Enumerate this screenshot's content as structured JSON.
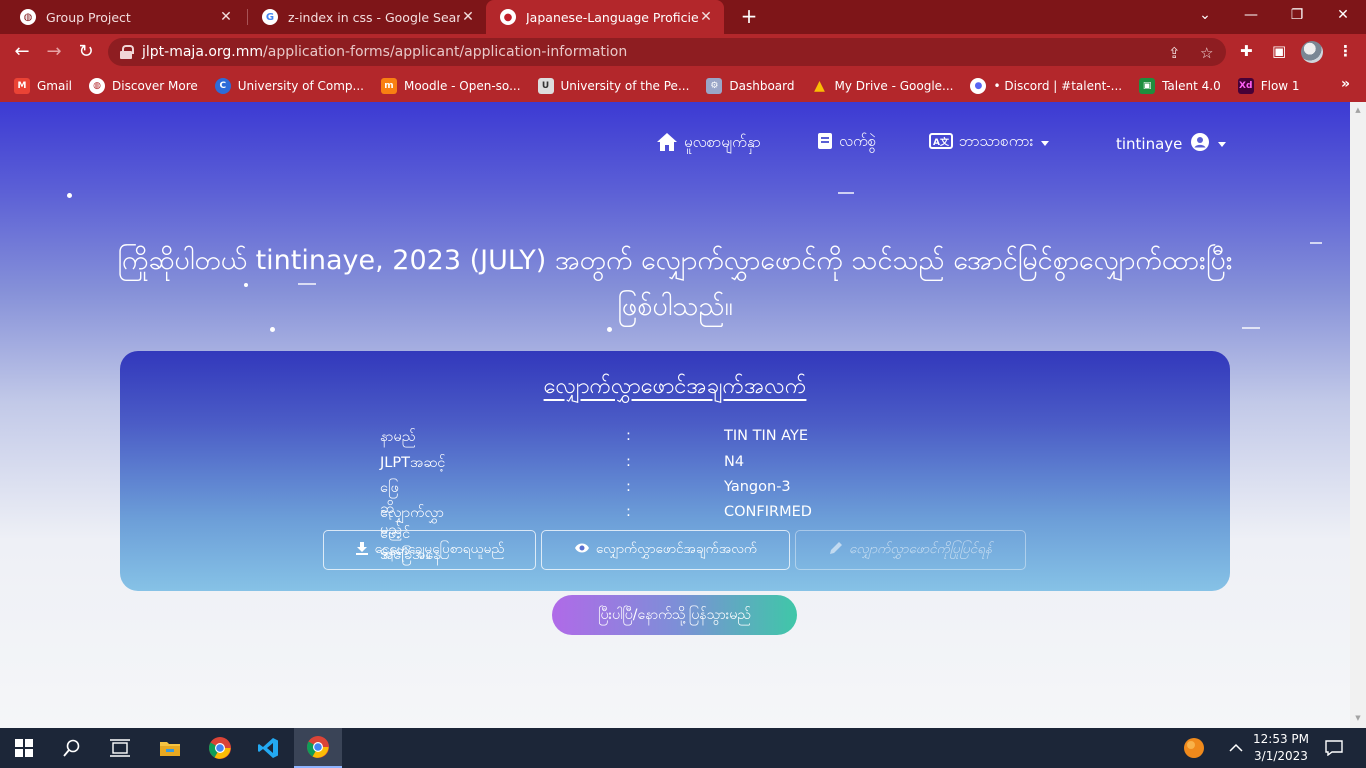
{
  "browser": {
    "tabs": [
      {
        "title": "Group Project",
        "icon": "globe-icon",
        "active": false
      },
      {
        "title": "z-index in css - Google Search",
        "icon": "google-icon",
        "active": false
      },
      {
        "title": "Japanese-Language Proficiency Test",
        "icon": "jlpt-icon",
        "active": true
      }
    ],
    "close_glyph": "✕",
    "new_tab_glyph": "+",
    "url_host": "jlpt-maja.org.mm",
    "url_path": "/application-forms/applicant/application-information",
    "bookmarks": [
      {
        "label": "Gmail",
        "icon": "gmail-icon",
        "color": "#ea4335"
      },
      {
        "label": "Discover More",
        "icon": "globe-icon",
        "color": "#ffffff"
      },
      {
        "label": "University of Comp...",
        "icon": "c-icon",
        "color": "#2d6bd8"
      },
      {
        "label": "Moodle - Open-so...",
        "icon": "moodle-icon",
        "color": "#f98012"
      },
      {
        "label": "University of the Pe...",
        "icon": "uop-icon",
        "color": "#dddddd"
      },
      {
        "label": "Dashboard",
        "icon": "dashboard-icon",
        "color": "#9aa6c8"
      },
      {
        "label": "My Drive - Google...",
        "icon": "drive-icon",
        "color": "#1fa463"
      },
      {
        "label": "• Discord | #talent-...",
        "icon": "discord-icon",
        "color": "#ffffff"
      },
      {
        "label": "Talent 4.0",
        "icon": "classroom-icon",
        "color": "#1e8e3e"
      },
      {
        "label": "Flow 1",
        "icon": "xd-icon",
        "color": "#470137"
      }
    ]
  },
  "nav": {
    "home": "မူလစာမျက်နှာ",
    "manual": "လက်စွဲ",
    "language": "ဘာသာစကား",
    "user": "tintinaye"
  },
  "headline": "ကြိုဆိုပါတယ် tintinaye, 2023 (JULY) အတွက် လျှောက်လွှာဖောင်ကို သင်သည် အောင်မြင်စွာလျှောက်ထားပြီးဖြစ်ပါသည်။",
  "card": {
    "title": "လျှောက်လွှာဖောင်အချက်အလက်",
    "separator": ":",
    "rows": [
      {
        "label": "နာမည်",
        "value": "TIN TIN AYE"
      },
      {
        "label": "JLPTအဆင့်",
        "value": "N4"
      },
      {
        "label": "ဖြေဆိုမည့်နေရာ",
        "value": "Yangon-3"
      },
      {
        "label": "လျှောက်လွှာဖောင်အခြေအနေ",
        "value": "CONFIRMED"
      }
    ],
    "buttons": {
      "download": "ငွေပေးချေမှုပြေစာရယူမည်",
      "view": "လျှောက်လွှာဖောင်အချက်အလက်",
      "edit": "လျှောက်လွှာဖောင်ကိုပြုပြင်ရန်"
    }
  },
  "finish_button": "ပြီးပါပြီ/နောက်သို့ပြန်သွားမည်",
  "taskbar": {
    "time": "12:53 PM",
    "date": "3/1/2023"
  }
}
